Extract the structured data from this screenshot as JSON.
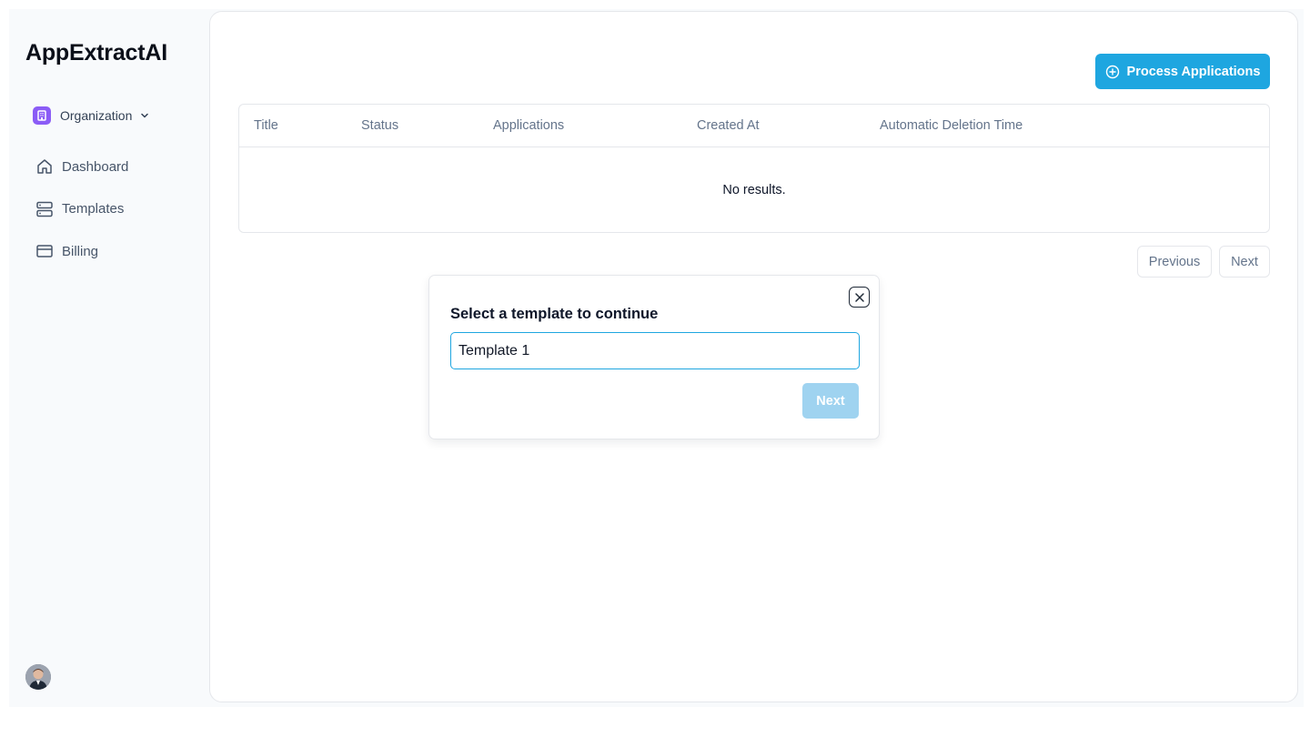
{
  "app": {
    "brand": "AppExtractAI"
  },
  "sidebar": {
    "organization": {
      "label": "Organization",
      "icon": "building-icon",
      "chevron": "chevron-down-icon",
      "badge_color": "#8b5cf6"
    },
    "items": [
      {
        "label": "Dashboard",
        "icon": "home-icon"
      },
      {
        "label": "Templates",
        "icon": "server-icon"
      },
      {
        "label": "Billing",
        "icon": "credit-card-icon"
      }
    ],
    "avatar": "user-avatar"
  },
  "main": {
    "process_button": {
      "label": "Process Applications",
      "icon": "plus-circle-icon",
      "color": "#1ea6e0"
    },
    "table": {
      "columns": [
        "Title",
        "Status",
        "Applications",
        "Created At",
        "Automatic Deletion Time"
      ],
      "rows": [],
      "empty_message": "No results."
    },
    "pagination": {
      "previous_label": "Previous",
      "next_label": "Next"
    }
  },
  "modal": {
    "title": "Select a template to continue",
    "input_value": "Template 1",
    "next_label": "Next",
    "close_icon": "close-icon",
    "next_color": "#9fd3f0"
  }
}
